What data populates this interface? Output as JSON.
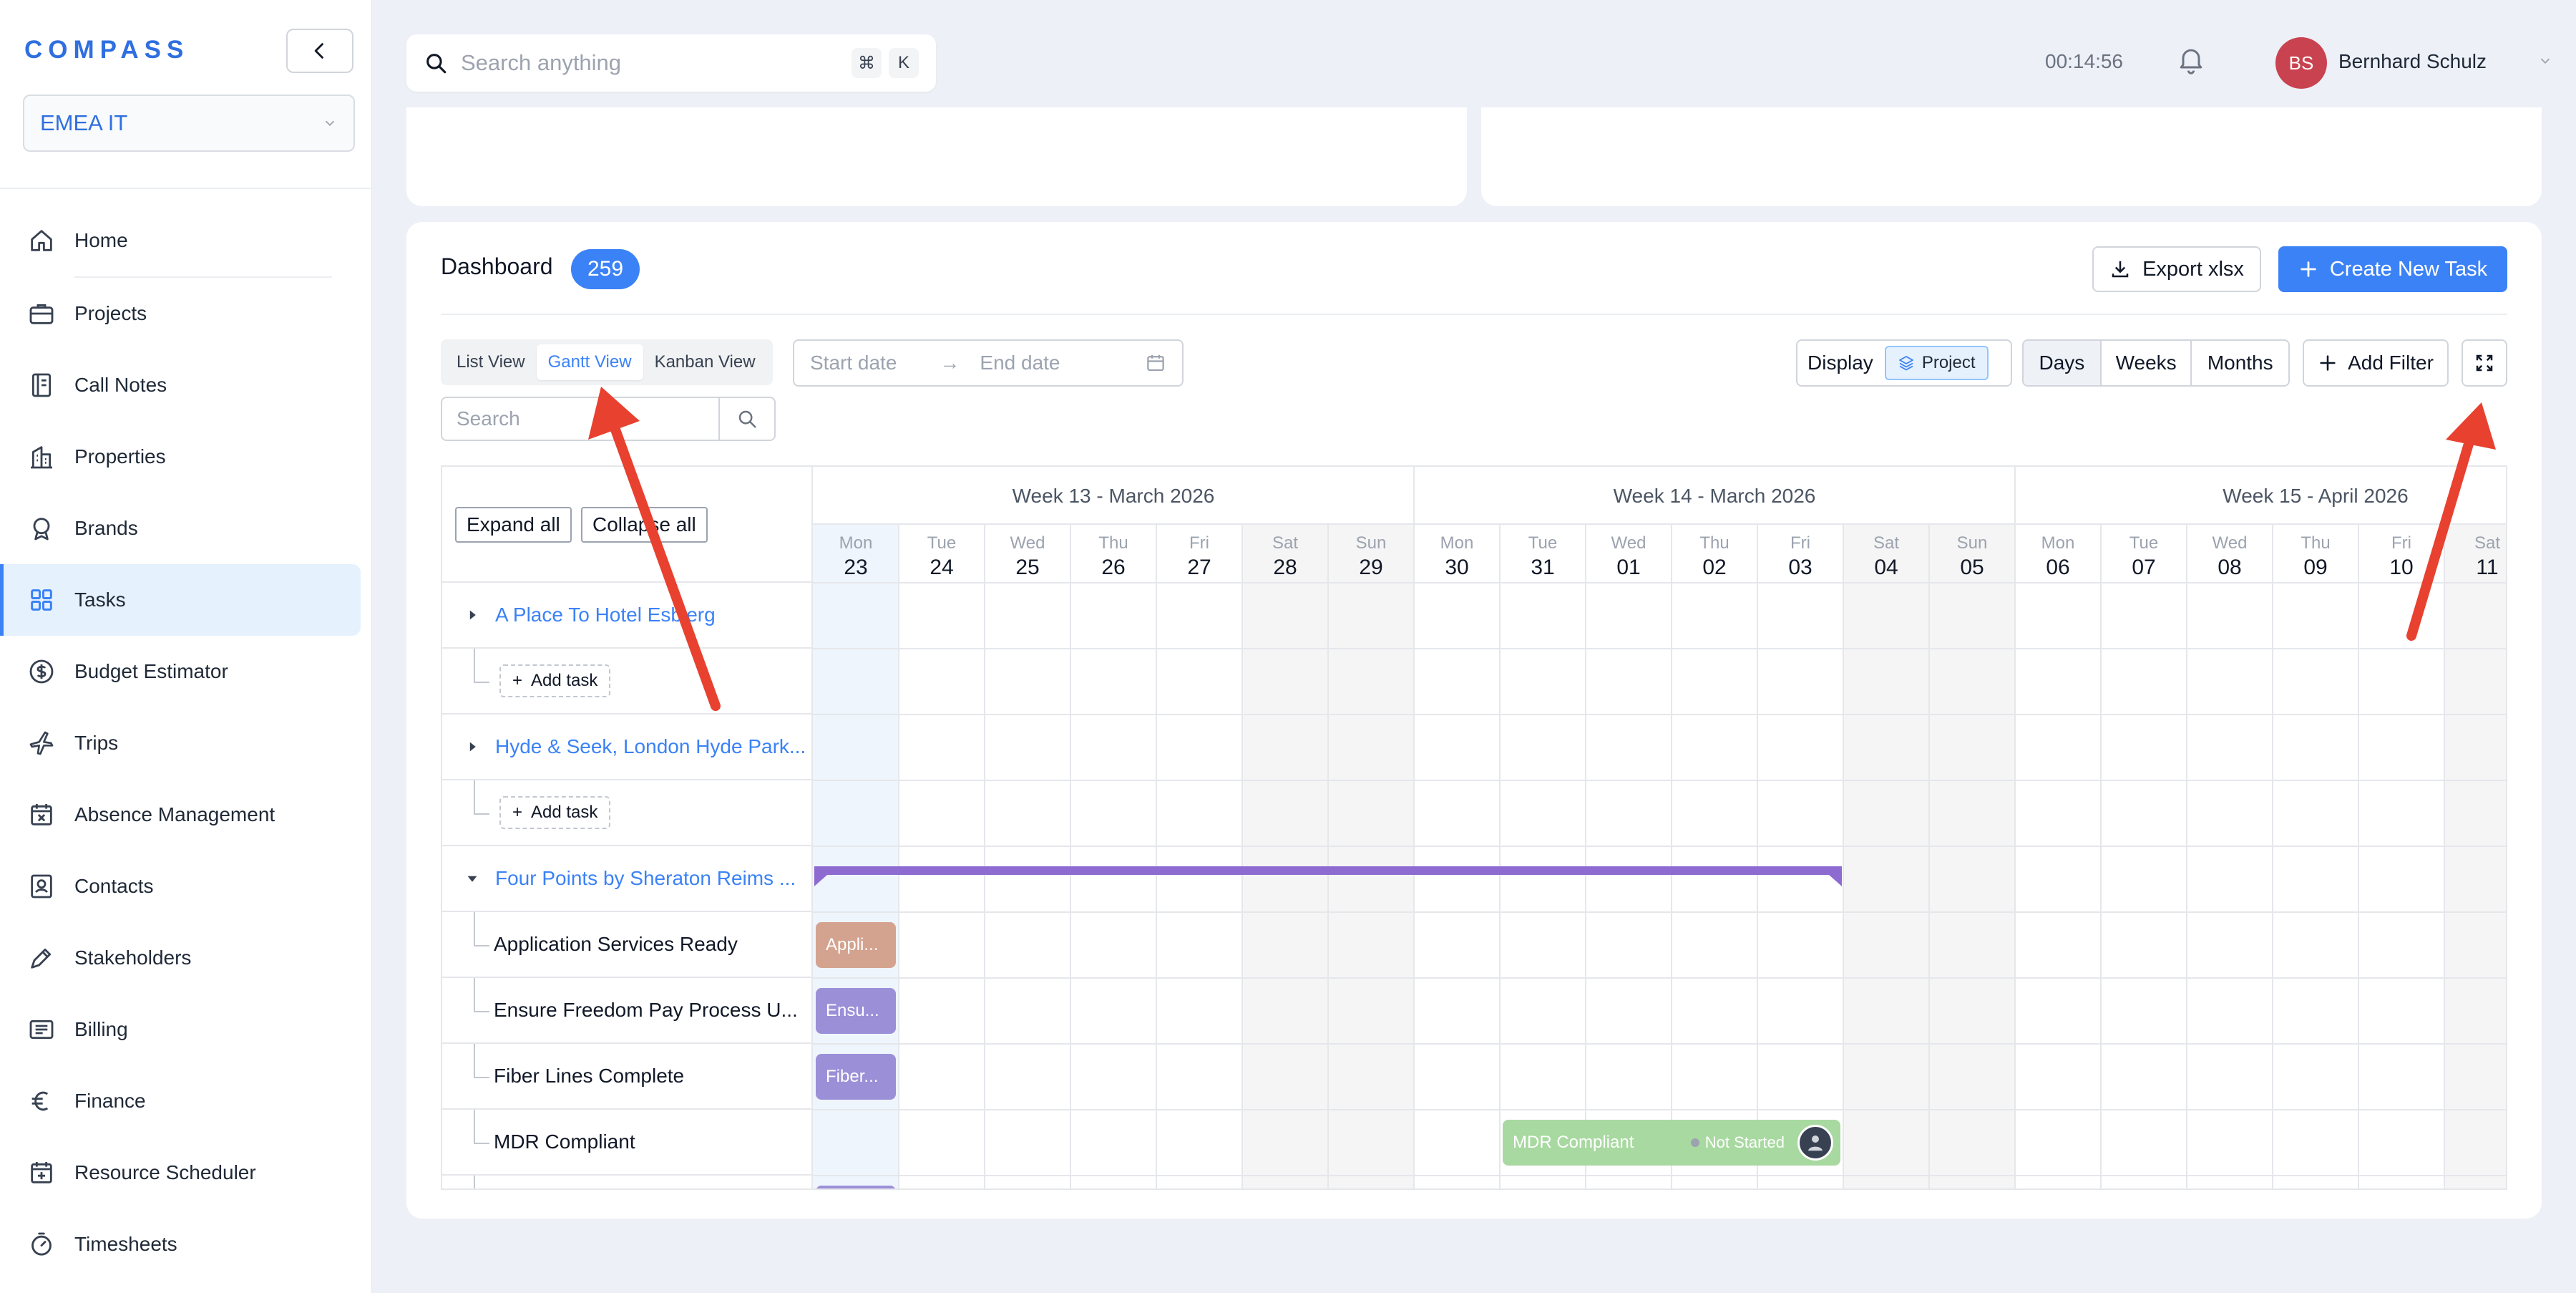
{
  "brand": {
    "logo": "COMPASS"
  },
  "org": {
    "selected": "EMEA IT"
  },
  "nav": {
    "items": [
      {
        "label": "Home",
        "icon": "home-icon"
      },
      {
        "label": "Projects",
        "icon": "briefcase-icon"
      },
      {
        "label": "Call Notes",
        "icon": "notebook-icon"
      },
      {
        "label": "Properties",
        "icon": "building-icon"
      },
      {
        "label": "Brands",
        "icon": "award-icon"
      },
      {
        "label": "Tasks",
        "icon": "grid-icon",
        "active": true
      },
      {
        "label": "Budget Estimator",
        "icon": "dollar-icon"
      },
      {
        "label": "Trips",
        "icon": "plane-icon"
      },
      {
        "label": "Absence Management",
        "icon": "calendar-x-icon"
      },
      {
        "label": "Contacts",
        "icon": "contact-icon"
      },
      {
        "label": "Stakeholders",
        "icon": "pen-icon"
      },
      {
        "label": "Billing",
        "icon": "billing-icon"
      },
      {
        "label": "Finance",
        "icon": "euro-icon"
      },
      {
        "label": "Resource Scheduler",
        "icon": "calendar-plus-icon"
      },
      {
        "label": "Timesheets",
        "icon": "stopwatch-icon"
      }
    ]
  },
  "topbar": {
    "search_placeholder": "Search anything",
    "kbd1": "⌘",
    "kbd2": "K",
    "timer": "00:14:56",
    "user_initials": "BS",
    "user_name": "Bernhard Schulz"
  },
  "dashboard": {
    "title": "Dashboard",
    "count": "259",
    "export_label": "Export xlsx",
    "create_label": "Create New Task",
    "views": [
      "List View",
      "Gantt View",
      "Kanban View"
    ],
    "active_view": "Gantt View",
    "start_placeholder": "Start date",
    "end_placeholder": "End date",
    "search_placeholder": "Search",
    "display_label": "Display",
    "display_chip": "Project",
    "scales": [
      "Days",
      "Weeks",
      "Months"
    ],
    "active_scale": "Days",
    "add_filter_label": "Add Filter",
    "expand_all": "Expand all",
    "collapse_all": "Collapse all"
  },
  "gantt": {
    "weeks": [
      "Week 13 - March 2026",
      "Week 14 - March 2026",
      "Week 15 - April 2026"
    ],
    "days": [
      {
        "dow": "Mon",
        "num": "23"
      },
      {
        "dow": "Tue",
        "num": "24"
      },
      {
        "dow": "Wed",
        "num": "25"
      },
      {
        "dow": "Thu",
        "num": "26"
      },
      {
        "dow": "Fri",
        "num": "27"
      },
      {
        "dow": "Sat",
        "num": "28"
      },
      {
        "dow": "Sun",
        "num": "29"
      },
      {
        "dow": "Mon",
        "num": "30"
      },
      {
        "dow": "Tue",
        "num": "31"
      },
      {
        "dow": "Wed",
        "num": "01"
      },
      {
        "dow": "Thu",
        "num": "02"
      },
      {
        "dow": "Fri",
        "num": "03"
      },
      {
        "dow": "Sat",
        "num": "04"
      },
      {
        "dow": "Sun",
        "num": "05"
      },
      {
        "dow": "Mon",
        "num": "06"
      },
      {
        "dow": "Tue",
        "num": "07"
      },
      {
        "dow": "Wed",
        "num": "08"
      },
      {
        "dow": "Thu",
        "num": "09"
      },
      {
        "dow": "Fri",
        "num": "10"
      },
      {
        "dow": "Sat",
        "num": "11"
      }
    ],
    "rows": [
      {
        "type": "project",
        "label": "A Place To Hotel Esbjerg",
        "expanded": false
      },
      {
        "type": "add",
        "label": "Add task"
      },
      {
        "type": "project",
        "label": "Hyde & Seek, London Hyde Park...",
        "expanded": false
      },
      {
        "type": "add",
        "label": "Add task"
      },
      {
        "type": "project",
        "label": "Four Points by Sheraton Reims ...",
        "expanded": true
      },
      {
        "type": "task",
        "label": "Application Services Ready"
      },
      {
        "type": "task",
        "label": "Ensure Freedom Pay Process U..."
      },
      {
        "type": "task",
        "label": "Fiber Lines Complete"
      },
      {
        "type": "task",
        "label": "MDR Compliant"
      }
    ],
    "bars": [
      {
        "row": 5,
        "start": 0,
        "days": 1,
        "label": "Appli...",
        "color": "#d4a38f"
      },
      {
        "row": 6,
        "start": 0,
        "days": 1,
        "label": "Ensu...",
        "color": "#9b8fd8"
      },
      {
        "row": 7,
        "start": 0,
        "days": 1,
        "label": "Fiber...",
        "color": "#9b8fd8"
      },
      {
        "row": 8,
        "start": 8,
        "days": 4,
        "label": "MDR Compliant",
        "status": "Not Started",
        "color": "#a8d9a0"
      }
    ],
    "project_span": {
      "row": 4,
      "start": 0,
      "days": 12,
      "color": "#8e6bd1"
    }
  },
  "colors": {
    "accent": "#3b82f6",
    "annotation": "#e8412f"
  }
}
